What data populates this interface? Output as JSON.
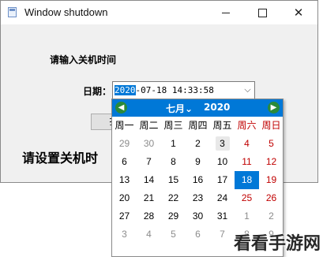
{
  "window": {
    "title": "Window shutdown",
    "controls": {
      "minimize": "minimize",
      "maximize": "maximize",
      "close": "✕"
    }
  },
  "form": {
    "heading": "请输入关机时间",
    "date_label": "日期：",
    "date_value_selected": "2020",
    "date_value_rest": "-07-18 14:33:58",
    "dropdown_glyph": "⌵",
    "partial_button_label": "扌",
    "status_text": "请设置关机时"
  },
  "calendar": {
    "month": "七月",
    "year": "2020",
    "prev_glyph": "◀",
    "next_glyph": "▶",
    "weekdays": [
      "周一",
      "周二",
      "周三",
      "周四",
      "周五",
      "周六",
      "周日"
    ],
    "weeks": [
      [
        "29",
        "30",
        "1",
        "2",
        "3",
        "4",
        "5"
      ],
      [
        "6",
        "7",
        "8",
        "9",
        "10",
        "11",
        "12"
      ],
      [
        "13",
        "14",
        "15",
        "16",
        "17",
        "18",
        "19"
      ],
      [
        "20",
        "21",
        "22",
        "23",
        "24",
        "25",
        "26"
      ],
      [
        "27",
        "28",
        "29",
        "30",
        "31",
        "1",
        "2"
      ],
      [
        "3",
        "4",
        "5",
        "6",
        "7",
        "8",
        "9"
      ]
    ],
    "selected_day": "18",
    "today_day": "3"
  },
  "watermark": "看看手游网",
  "colors": {
    "accent": "#0078d7",
    "weekend": "#c00000",
    "nav_button": "#2a8a3a"
  }
}
